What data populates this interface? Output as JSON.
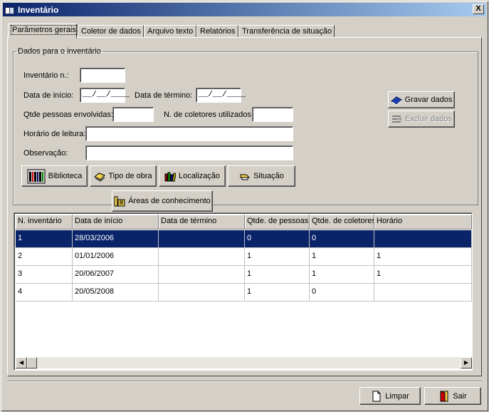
{
  "window": {
    "title": "Inventário",
    "close_glyph": "X"
  },
  "tabs": [
    {
      "label": "Parâmetros gerais",
      "active": true
    },
    {
      "label": "Coletor de dados",
      "active": false
    },
    {
      "label": "Arquivo texto",
      "active": false
    },
    {
      "label": "Relatórios",
      "active": false
    },
    {
      "label": "Transferência de situação",
      "active": false
    }
  ],
  "form": {
    "group_title": "Dados para o inventário",
    "inventario_label": "Inventário n.:",
    "inventario_value": "",
    "data_inicio_label": "Data de início:",
    "data_inicio_value": "__/__/____",
    "data_termino_label": "Data de término:",
    "data_termino_value": "__/__/____",
    "qtde_pessoas_label": "Qtde pessoas envolvidas:",
    "qtde_pessoas_value": "",
    "n_coletores_label": "N. de coletores utilizados:",
    "n_coletores_value": "",
    "horario_label": "Horário de leitura:",
    "horario_value": "",
    "observacao_label": "Observação:",
    "observacao_value": ""
  },
  "buttons": {
    "gravar": "Gravar dados",
    "excluir": "Excluir dados",
    "biblioteca": "Biblioteca",
    "tipo_obra": "Tipo de obra",
    "localizacao": "Localização",
    "situacao": "Situação",
    "areas": "Áreas de conhecimento",
    "limpar": "Limpar",
    "sair": "Sair"
  },
  "grid": {
    "columns": [
      "N. inventário",
      "Data de início",
      "Data de término",
      "Qtde. de pessoas",
      "Qtde. de coletores",
      "Horário"
    ],
    "rows": [
      {
        "n": "1",
        "inicio": "28/03/2006",
        "termino": "",
        "pessoas": "0",
        "coletores": "0",
        "horario": "",
        "selected": true
      },
      {
        "n": "2",
        "inicio": "01/01/2006",
        "termino": "",
        "pessoas": "1",
        "coletores": "1",
        "horario": "1",
        "selected": false
      },
      {
        "n": "3",
        "inicio": "20/06/2007",
        "termino": "",
        "pessoas": "1",
        "coletores": "1",
        "horario": "1",
        "selected": false
      },
      {
        "n": "4",
        "inicio": "20/05/2008",
        "termino": "",
        "pessoas": "1",
        "coletores": "0",
        "horario": "",
        "selected": false
      }
    ]
  },
  "colors": {
    "selection": "#0a246a",
    "face": "#d4d0c8"
  }
}
